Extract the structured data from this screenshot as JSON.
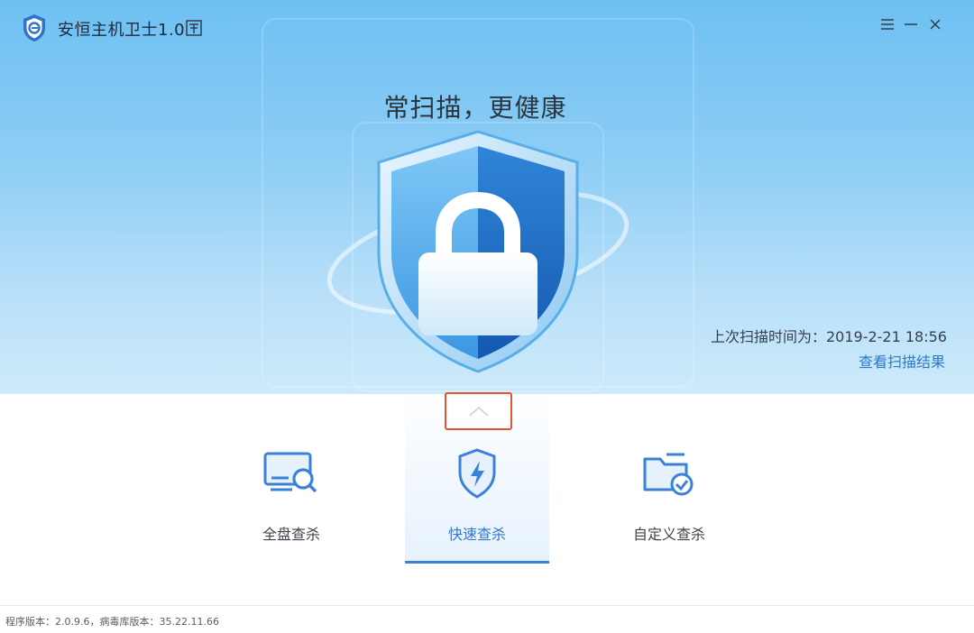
{
  "app": {
    "title": "安恒主机卫士1.0"
  },
  "window_controls": {
    "menu": "menu-icon",
    "minimize": "minimize-icon",
    "close": "close-icon"
  },
  "hero": {
    "slogan": "常扫描，更健康",
    "last_scan_label": "上次扫描时间为：2019-2-21 18:56",
    "view_result_link": "查看扫描结果"
  },
  "scan_modes": [
    {
      "label": "全盘查杀",
      "icon": "monitor-search-icon",
      "selected": false
    },
    {
      "label": "快速查杀",
      "icon": "shield-lightning-icon",
      "selected": true
    },
    {
      "label": "自定义查杀",
      "icon": "folder-check-icon",
      "selected": false
    }
  ],
  "footer": {
    "version_text": "程序版本：2.0.9.6，病毒库版本：35.22.11.66"
  },
  "colors": {
    "accent": "#3a82d8",
    "link": "#2f78c4",
    "highlight_border": "#e8532f",
    "hero_top": "#6ec0f3",
    "hero_bottom": "#cdeafb"
  }
}
